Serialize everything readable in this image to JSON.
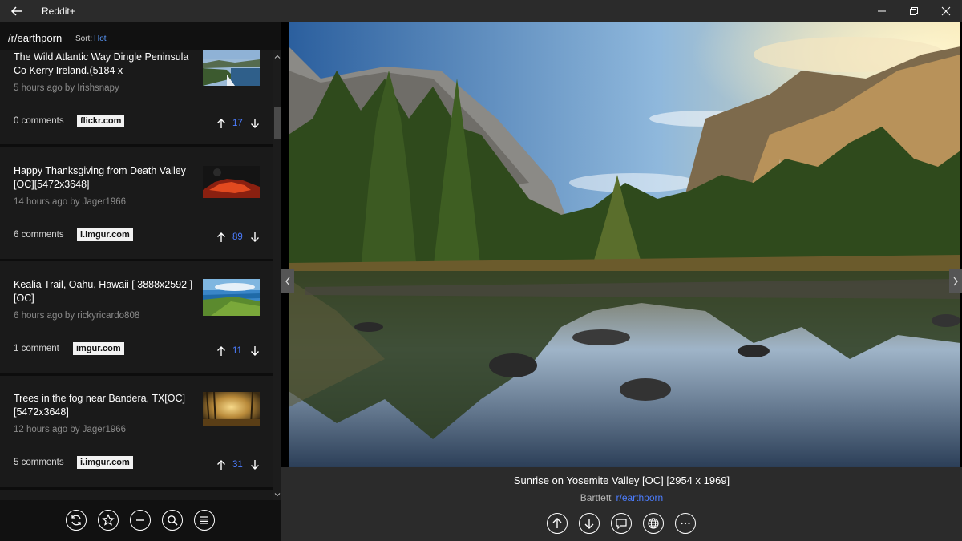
{
  "app": {
    "title": "Reddit+"
  },
  "subreddit_bar": {
    "name": "/r/earthporn",
    "sort_label": "Sort:",
    "sort_value": "Hot"
  },
  "posts": [
    {
      "title": "The Wild Atlantic Way Dingle Peninsula Co Kerry Ireland.(5184 x",
      "meta": "5 hours ago by Irishsnapy",
      "comments": "0 comments",
      "domain": "flickr.com",
      "score": "17"
    },
    {
      "title": "Happy Thanksgiving from Death Valley [OC][5472x3648]",
      "meta": "14 hours ago by Jager1966",
      "comments": "6 comments",
      "domain": "i.imgur.com",
      "score": "89"
    },
    {
      "title": "Kealia Trail, Oahu, Hawaii [ 3888x2592 ] [OC]",
      "meta": "6 hours ago by rickyricardo808",
      "comments": "1 comment",
      "domain": "imgur.com",
      "score": "11"
    },
    {
      "title": "Trees in the fog near Bandera, TX[OC] [5472x3648]",
      "meta": "12 hours ago by Jager1966",
      "comments": "5 comments",
      "domain": "i.imgur.com",
      "score": "31"
    }
  ],
  "left_toolbar": {
    "icons": [
      "refresh-icon",
      "star-icon",
      "minus-icon",
      "search-icon",
      "list-icon"
    ]
  },
  "viewer": {
    "caption": "Sunrise on Yosemite Valley [OC] [2954 x 1969]",
    "author": "Bartfett",
    "subreddit": "r/earthporn",
    "icons": [
      "upvote-icon",
      "downvote-icon",
      "comment-icon",
      "globe-icon",
      "more-icon"
    ]
  },
  "colors": {
    "accent": "#4c7dff",
    "sort_accent": "#5b9bff",
    "titlebar": "#2b2b2b",
    "panel": "#1a1a1a"
  }
}
